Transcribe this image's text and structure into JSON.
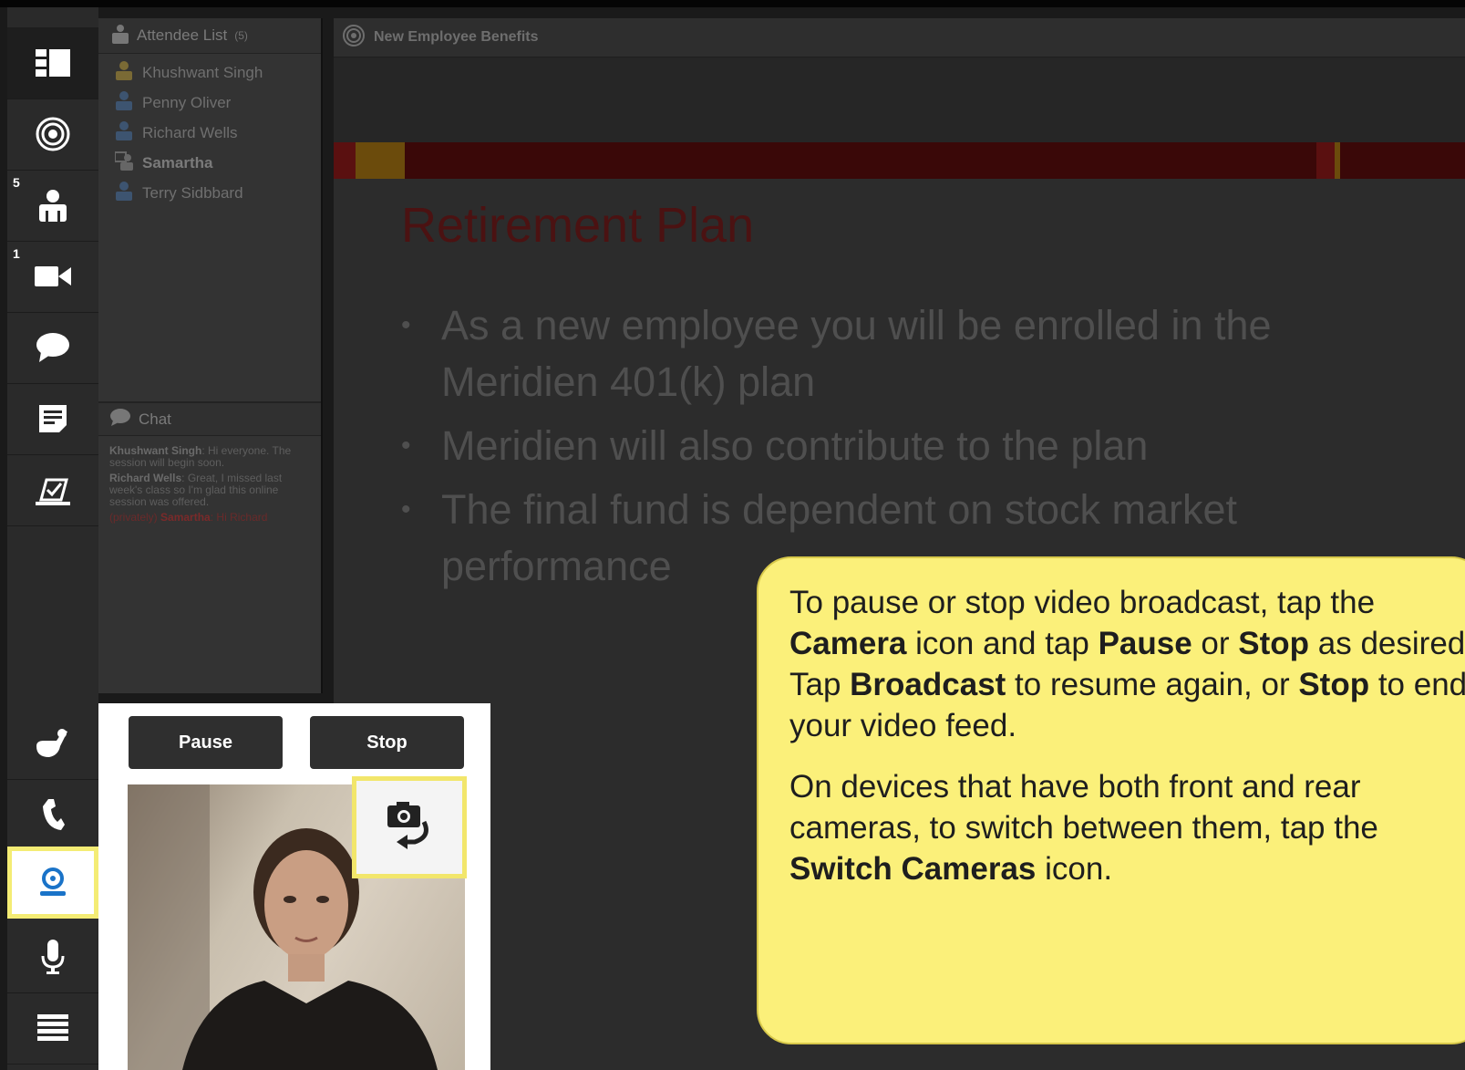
{
  "rail": {
    "items": [
      {
        "icon": "layouts-icon"
      },
      {
        "icon": "share-pod-icon"
      },
      {
        "icon": "attendees-icon",
        "badge": "5"
      },
      {
        "icon": "video-icon",
        "badge": "1"
      },
      {
        "icon": "chat-icon"
      },
      {
        "icon": "notes-icon"
      },
      {
        "icon": "poll-icon"
      },
      {
        "icon": "raise-hand-icon"
      },
      {
        "icon": "phone-icon"
      },
      {
        "icon": "camera-icon"
      },
      {
        "icon": "microphone-icon"
      },
      {
        "icon": "menu-icon"
      }
    ]
  },
  "attendee_list": {
    "title": "Attendee List",
    "count": "(5)",
    "attendees": [
      {
        "name": "Khushwant Singh",
        "role": "host"
      },
      {
        "name": "Penny Oliver",
        "role": "participant"
      },
      {
        "name": "Richard Wells",
        "role": "participant"
      },
      {
        "name": "Samartha",
        "role": "presenter"
      },
      {
        "name": "Terry Sidbbard",
        "role": "participant"
      }
    ]
  },
  "chat": {
    "title": "Chat",
    "messages": [
      {
        "sender": "Khushwant Singh",
        "text": "Hi everyone. The session will begin soon."
      },
      {
        "sender": "Richard Wells",
        "text": "Great, I missed last week's class so I'm glad this online session was offered."
      }
    ],
    "private_message": {
      "prefix": "(privately)",
      "sender": "Samartha",
      "text": "Hi Richard"
    }
  },
  "pod": {
    "title": "New Employee Benefits",
    "slide": {
      "title": "Retirement Plan",
      "bullets": [
        "As a new employee you will be enrolled in the Meridien 401(k) plan",
        "Meridien will also contribute to the plan",
        "The final fund is dependent on stock market performance"
      ]
    }
  },
  "video": {
    "pause_label": "Pause",
    "stop_label": "Stop"
  },
  "callout": {
    "p1": {
      "t1": "To pause or stop video broadcast, tap the ",
      "b1": "Camera",
      "t2": " icon and tap ",
      "b2": "Pause",
      "t3": " or ",
      "b3": "Stop",
      "t4": " as desired.  Tap ",
      "b4": "Broadcast",
      "t5": " to resume again, or ",
      "b5": "Stop",
      "t6": " to end your video feed."
    },
    "p2": {
      "t1": "On devices that have both front and rear cameras, to switch between them, tap the ",
      "b1": "Switch Cameras",
      "t2": " icon."
    }
  },
  "colors": {
    "highlight": "#f4ec74",
    "active_icon": "#1a73c8",
    "callout_bg": "#fbf07a",
    "slide_title": "#4b1212"
  }
}
